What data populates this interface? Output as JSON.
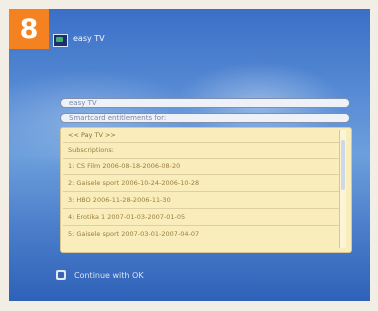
{
  "step_badge": "8",
  "header": {
    "title": "easy TV"
  },
  "fields": {
    "service": "easy TV",
    "smartcard_label": "Smartcard entitlements for:"
  },
  "entitlements": {
    "header": "<< Pay TV >>",
    "subtitle": "Subscriptions:",
    "items": [
      "1: CS Film  2006-08-18-2006-08-20",
      "2: Gaisele sport  2006-10-24-2006-10-28",
      "3: HBO  2006-11-28-2006-11-30",
      "4: Erotika 1  2007-01-03-2007-01-05",
      "5: Gaisele sport  2007-03-01-2007-04-07"
    ]
  },
  "footer": {
    "hint": "Continue with OK"
  },
  "colors": {
    "badge": "#f58220",
    "panel": "#f9edbc",
    "screen": "#4c7fcb"
  }
}
